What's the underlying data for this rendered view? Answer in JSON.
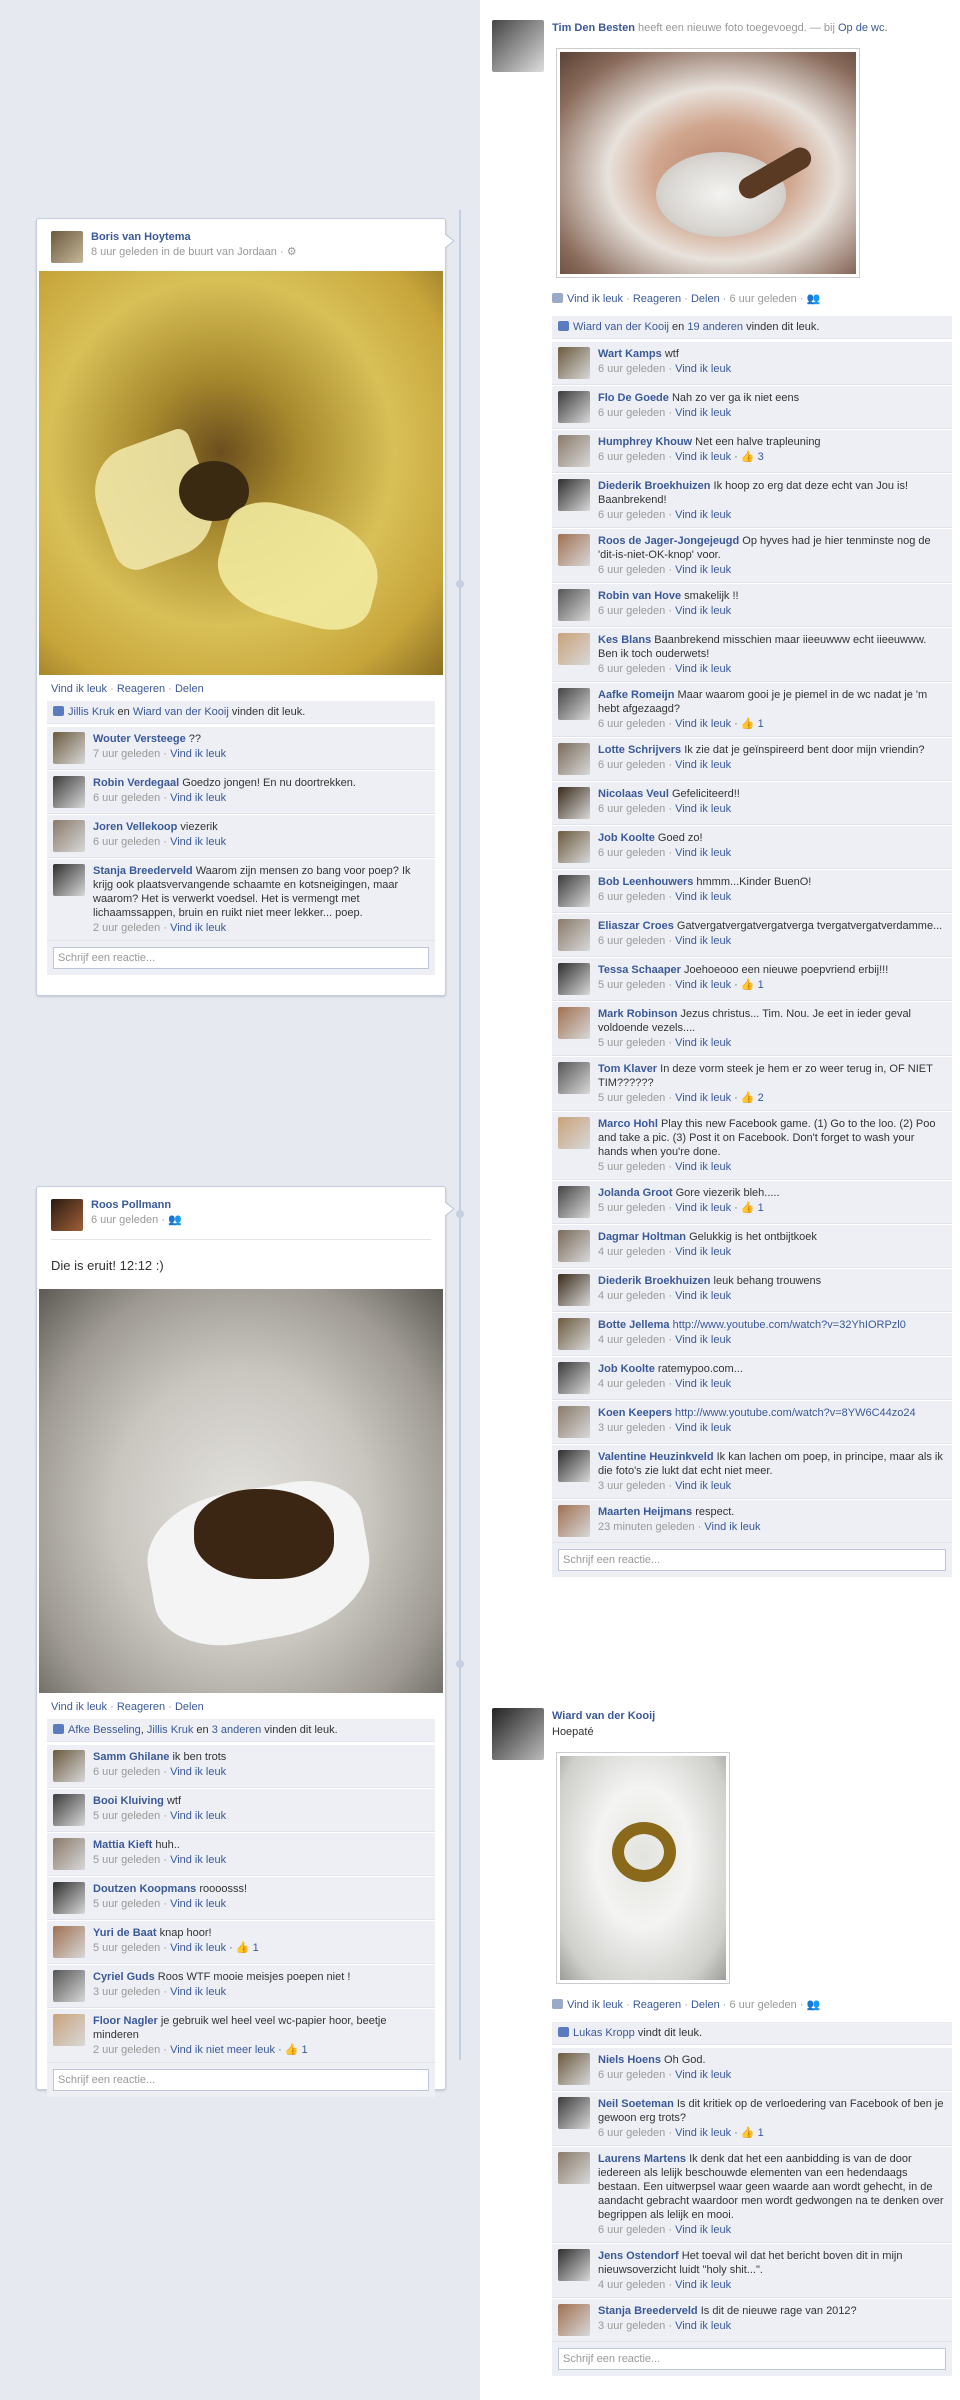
{
  "post_left1": {
    "author": "Boris van Hoytema",
    "sub": "8 uur geleden in de buurt van Jordaan · ⚙",
    "actions": [
      "Vind ik leuk",
      "Reageren",
      "Delen"
    ],
    "likes": {
      "a": "Jillis Kruk",
      "en": " en ",
      "b": "Wiard van der Kooij",
      "rest": " vinden dit leuk."
    },
    "comments": [
      {
        "name": "Wouter Versteege",
        "text": " ??",
        "time": "7 uur geleden · ",
        "like": "Vind ik leuk"
      },
      {
        "name": "Robin Verdegaal",
        "text": " Goedzo jongen! En nu doortrekken.",
        "time": "6 uur geleden · ",
        "like": "Vind ik leuk"
      },
      {
        "name": "Joren Vellekoop",
        "text": " viezerik",
        "time": "6 uur geleden · ",
        "like": "Vind ik leuk"
      },
      {
        "name": "Stanja Breederveld",
        "text": " Waarom zijn mensen zo bang voor poep? Ik krijg ook plaatsvervangende schaamte en kotsneigingen, maar waarom? Het is verwerkt voedsel. Het is vermengt met lichaamssappen, bruin en ruikt niet meer lekker... poep.",
        "time": "2 uur geleden · ",
        "like": "Vind ik leuk"
      }
    ],
    "reply": "Schrijf een reactie..."
  },
  "post_left2": {
    "author": "Roos Pollmann",
    "sub": "6 uur geleden · 👥",
    "status": "Die is eruit! 12:12 :)",
    "actions": [
      "Vind ik leuk",
      "Reageren",
      "Delen"
    ],
    "likes": {
      "a": "Afke Besseling",
      "c": ", ",
      "b": "Jillis Kruk",
      "en": " en ",
      "d": "3 anderen",
      "rest": " vinden dit leuk."
    },
    "comments": [
      {
        "name": "Samm Ghilane",
        "text": " ik ben trots",
        "time": "6 uur geleden · ",
        "like": "Vind ik leuk"
      },
      {
        "name": "Booi Kluiving",
        "text": " wtf",
        "time": "5 uur geleden · ",
        "like": "Vind ik leuk"
      },
      {
        "name": "Mattia Kieft",
        "text": " huh..",
        "time": "5 uur geleden · ",
        "like": "Vind ik leuk"
      },
      {
        "name": "Doutzen Koopmans",
        "text": " roooosss!",
        "time": "5 uur geleden · ",
        "like": "Vind ik leuk"
      },
      {
        "name": "Yuri de Baat",
        "text": " knap hoor!",
        "time": "5 uur geleden · ",
        "like": "Vind ik leuk",
        "extra": " · 👍 1"
      },
      {
        "name": "Cyriel Guds",
        "text": " Roos WTF mooie meisjes poepen niet !",
        "time": "3 uur geleden · ",
        "like": "Vind ik leuk"
      },
      {
        "name": "Floor Nagler",
        "text": " je gebruik wel heel veel wc-papier hoor, beetje minderen",
        "time": "2 uur geleden · ",
        "like": "Vind ik niet meer leuk",
        "extra": " · 👍 1"
      }
    ],
    "reply": "Schrijf een reactie..."
  },
  "post_right1": {
    "author": "Tim Den Besten",
    "sub1": " heeft een nieuwe foto toegevoegd. — bij ",
    "place": "Op de wc.",
    "actions": [
      "Vind ik leuk",
      "Reageren",
      "Delen"
    ],
    "time": " · 6 uur geleden · 👥",
    "likes": {
      "a": "Wiard van der Kooij",
      "en": " en ",
      "b": "19 anderen",
      "rest": " vinden dit leuk."
    },
    "comments": [
      {
        "name": "Wart Kamps",
        "text": " wtf",
        "time": "6 uur geleden · ",
        "like": "Vind ik leuk"
      },
      {
        "name": "Flo De Goede",
        "text": " Nah zo ver ga ik niet eens",
        "time": "6 uur geleden · ",
        "like": "Vind ik leuk"
      },
      {
        "name": "Humphrey Khouw",
        "text": " Net een halve trapleuning",
        "time": "6 uur geleden · ",
        "like": "Vind ik leuk",
        "extra": " · 👍 3"
      },
      {
        "name": "Diederik Broekhuizen",
        "text": " Ik hoop zo erg dat deze echt van Jou is! Baanbrekend!",
        "time": "6 uur geleden · ",
        "like": "Vind ik leuk"
      },
      {
        "name": "Roos de Jager-Jongejeugd",
        "text": " Op hyves had je hier tenminste nog de 'dit-is-niet-OK-knop' voor.",
        "time": "6 uur geleden · ",
        "like": "Vind ik leuk"
      },
      {
        "name": "Robin van Hove",
        "text": " smakelijk !!",
        "time": "6 uur geleden · ",
        "like": "Vind ik leuk"
      },
      {
        "name": "Kes Blans",
        "text": " Baanbrekend misschien maar iieeuwww echt iieeuwww. Ben ik toch ouderwets!",
        "time": "6 uur geleden · ",
        "like": "Vind ik leuk"
      },
      {
        "name": "Aafke Romeijn",
        "text": " Maar waarom gooi je je piemel in de wc nadat je 'm hebt afgezaagd?",
        "time": "6 uur geleden · ",
        "like": "Vind ik leuk",
        "extra": " · 👍 1"
      },
      {
        "name": "Lotte Schrijvers",
        "text": " Ik zie dat je geïnspireerd bent door mijn vriendin?",
        "time": "6 uur geleden · ",
        "like": "Vind ik leuk"
      },
      {
        "name": "Nicolaas Veul",
        "text": " Gefeliciteerd!!",
        "time": "6 uur geleden · ",
        "like": "Vind ik leuk"
      },
      {
        "name": "Job Koolte",
        "text": " Goed zo!",
        "time": "6 uur geleden · ",
        "like": "Vind ik leuk"
      },
      {
        "name": "Bob Leenhouwers",
        "text": " hmmm...Kinder BuenO!",
        "time": "6 uur geleden · ",
        "like": "Vind ik leuk"
      },
      {
        "name": "Eliaszar Croes",
        "text": " Gatvergatvergatvergatverga tvergatvergatverdamme...",
        "time": "6 uur geleden · ",
        "like": "Vind ik leuk"
      },
      {
        "name": "Tessa Schaaper",
        "text": " Joehoeooo een nieuwe poepvriend erbij!!!",
        "time": "5 uur geleden · ",
        "like": "Vind ik leuk",
        "extra": " · 👍 1"
      },
      {
        "name": "Mark Robinson",
        "text": " Jezus christus... Tim. Nou. Je eet in ieder geval voldoende vezels....",
        "time": "5 uur geleden · ",
        "like": "Vind ik leuk"
      },
      {
        "name": "Tom Klaver",
        "text": " In deze vorm steek je hem er zo weer terug in, OF NIET TIM??????",
        "time": "5 uur geleden · ",
        "like": "Vind ik leuk",
        "extra": " · 👍 2"
      },
      {
        "name": "Marco Hohl",
        "text": " Play this new Facebook game. (1) Go to the loo. (2) Poo and take a pic. (3) Post it on Facebook. Don't forget to wash your hands when you're done.",
        "time": "5 uur geleden · ",
        "like": "Vind ik leuk"
      },
      {
        "name": "Jolanda Groot",
        "text": " Gore viezerik bleh.....",
        "time": "5 uur geleden · ",
        "like": "Vind ik leuk",
        "extra": " · 👍 1"
      },
      {
        "name": "Dagmar Holtman",
        "text": " Gelukkig is het ontbijtkoek",
        "time": "4 uur geleden · ",
        "like": "Vind ik leuk"
      },
      {
        "name": "Diederik Broekhuizen",
        "text": " leuk behang trouwens",
        "time": "4 uur geleden · ",
        "like": "Vind ik leuk"
      },
      {
        "name": "Botte Jellema",
        "text": " ",
        "link": "http://www.youtube.com/watch?v=32YhIORPzl0",
        "time": "4 uur geleden · ",
        "like": "Vind ik leuk"
      },
      {
        "name": "Job Koolte",
        "text": " ratemypoo.com...",
        "time": "4 uur geleden · ",
        "like": "Vind ik leuk"
      },
      {
        "name": "Koen Keepers",
        "text": " ",
        "link": "http://www.youtube.com/watch?v=8YW6C44zo24",
        "time": "3 uur geleden · ",
        "like": "Vind ik leuk"
      },
      {
        "name": "Valentine Heuzinkveld",
        "text": " Ik kan lachen om poep, in principe, maar als ik die foto's zie lukt dat echt niet meer.",
        "time": "3 uur geleden · ",
        "like": "Vind ik leuk"
      },
      {
        "name": "Maarten Heijmans",
        "text": " respect.",
        "time": "23 minuten geleden · ",
        "like": "Vind ik leuk"
      }
    ],
    "reply": "Schrijf een reactie..."
  },
  "post_right2": {
    "author": "Wiard van der Kooij",
    "status": "Hoepaté",
    "actions": [
      "Vind ik leuk",
      "Reageren",
      "Delen"
    ],
    "time": " · 6 uur geleden · 👥",
    "likes": {
      "a": "Lukas Kropp",
      "rest": " vindt dit leuk."
    },
    "comments": [
      {
        "name": "Niels Hoens",
        "text": " Oh God.",
        "time": "6 uur geleden · ",
        "like": "Vind ik leuk"
      },
      {
        "name": "Neil Soeteman",
        "text": " Is dit kritiek op de verloedering van Facebook of ben je gewoon erg trots?",
        "time": "6 uur geleden · ",
        "like": "Vind ik leuk",
        "extra": " · 👍 1"
      },
      {
        "name": "Laurens Martens",
        "text": " Ik denk dat het een aanbidding is van de door iedereen als lelijk beschouwde elementen van een hedendaags bestaan. Een uitwerpsel waar geen waarde aan wordt gehecht, in de aandacht gebracht waardoor men wordt gedwongen na te denken over begrippen als lelijk en mooi.",
        "time": "6 uur geleden · ",
        "like": "Vind ik leuk"
      },
      {
        "name": "Jens Ostendorf",
        "text": " Het toeval wil dat het bericht boven dit in mijn nieuwsoverzicht luidt \"holy shit...\".",
        "time": "4 uur geleden · ",
        "like": "Vind ik leuk"
      },
      {
        "name": "Stanja Breederveld",
        "text": " Is dit de nieuwe rage van 2012?",
        "time": "3 uur geleden · ",
        "like": "Vind ik leuk"
      }
    ],
    "reply": "Schrijf een reactie..."
  }
}
